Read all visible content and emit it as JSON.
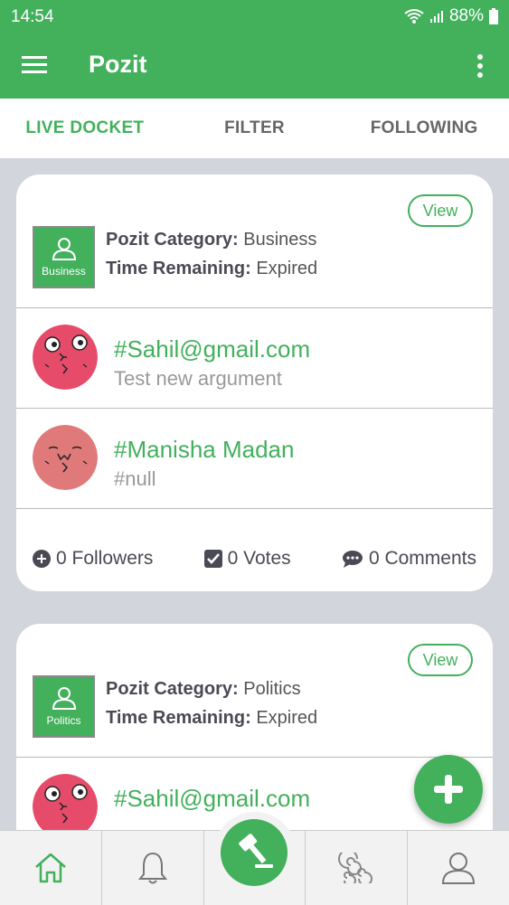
{
  "status_bar": {
    "time": "14:54",
    "battery": "88%"
  },
  "app_bar": {
    "title": "Pozit"
  },
  "tabs": [
    {
      "label": "LIVE DOCKET",
      "active": true
    },
    {
      "label": "FILTER",
      "active": false
    },
    {
      "label": "FOLLOWING",
      "active": false
    }
  ],
  "cards": [
    {
      "view_label": "View",
      "category_icon_label": "Business",
      "category_key": "Pozit Category:",
      "category_value": "Business",
      "time_key": "Time Remaining:",
      "time_value": "Expired",
      "entries": [
        {
          "name": "#Sahil@gmail.com",
          "text": "Test new argument"
        },
        {
          "name": "#Manisha Madan",
          "text": "#null"
        }
      ],
      "stats": {
        "followers": "0 Followers",
        "votes": "0 Votes",
        "comments": "0 Comments"
      }
    },
    {
      "view_label": "View",
      "category_icon_label": "Politics",
      "category_key": "Pozit Category:",
      "category_value": "Politics",
      "time_key": "Time Remaining:",
      "time_value": "Expired",
      "entries": [
        {
          "name": "#Sahil@gmail.com"
        }
      ]
    }
  ],
  "colors": {
    "brand": "#43b05c",
    "background": "#d3d5dc"
  },
  "bottom_nav": [
    "home-icon",
    "bell-icon",
    "gavel-icon",
    "swirl-icon",
    "user-icon"
  ]
}
